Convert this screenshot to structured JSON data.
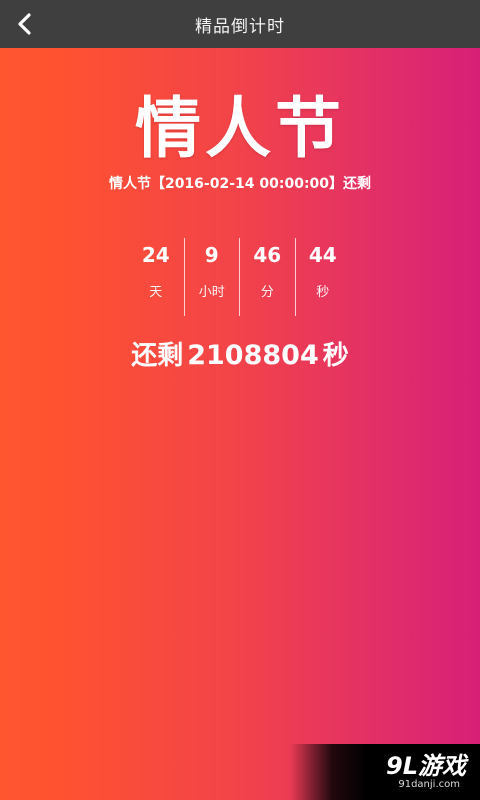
{
  "header": {
    "back_icon": "chevron-left-icon",
    "title": "精品倒计时"
  },
  "event": {
    "name": "情人节",
    "subtitle": "情人节【2016-02-14 00:00:00】还剩"
  },
  "countdown": [
    {
      "value": "24",
      "label": "天"
    },
    {
      "value": "9",
      "label": "小时"
    },
    {
      "value": "46",
      "label": "分"
    },
    {
      "value": "44",
      "label": "秒"
    }
  ],
  "remaining": {
    "prefix": "还剩",
    "seconds": "2108804",
    "suffix": "秒"
  },
  "watermark": {
    "logo": "9L游戏",
    "site": "91danji.com"
  },
  "colors": {
    "navbar": "#3f3f3f",
    "gradient_start": "#ff5630",
    "gradient_end": "#d81f78"
  }
}
